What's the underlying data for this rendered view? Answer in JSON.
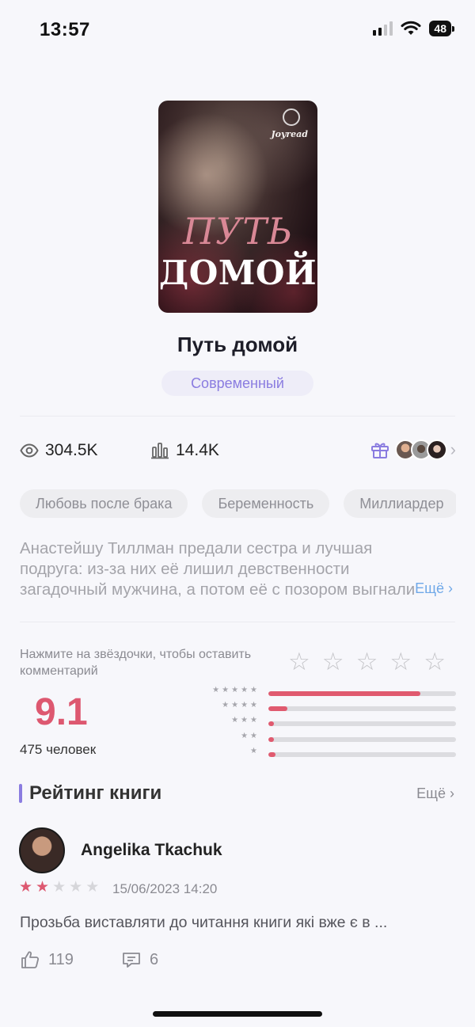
{
  "status_bar": {
    "time": "13:57",
    "battery": "48"
  },
  "book": {
    "cover_brand": "Joyread",
    "cover_title_line1": "ПУТЬ",
    "cover_title_line2": "ДОМОЙ",
    "title": "Путь домой",
    "genre": "Современный"
  },
  "stats": {
    "views": "304.5K",
    "popularity": "14.4K",
    "views_icon": "eye-icon",
    "popularity_icon": "bars-icon",
    "gift_icon": "gift-icon"
  },
  "tags": [
    "Любовь после брака",
    "Беременность",
    "Миллиардер"
  ],
  "description": {
    "text": "Анастейшу Тиллман предали сестра и лучшая подруга: из-за них её лишил девственности загадочный мужчина, а потом её с позором выгнали из дома.",
    "more_label": "Ещё ›"
  },
  "rating": {
    "hint": "Нажмите на звёздочки, чтобы оставить комментарий",
    "score": "9.1",
    "raters": "475 человек",
    "distribution": [
      {
        "stars": "★★★★★",
        "fraction": 0.81
      },
      {
        "stars": "★★★★",
        "fraction": 0.1
      },
      {
        "stars": "★★★",
        "fraction": 0.03
      },
      {
        "stars": "★★",
        "fraction": 0.03
      },
      {
        "stars": "★",
        "fraction": 0.04
      }
    ]
  },
  "reviews_section": {
    "title": "Рейтинг книги",
    "more_label": "Ещё ›"
  },
  "review": {
    "name": "Angelika Tkachuk",
    "stars": 2,
    "date": "15/06/2023 14:20",
    "text": "Прозьба виставляти до читання книги які вже є в ...",
    "likes": "119",
    "comments": "6"
  },
  "colors": {
    "accent": "#8a7ce0",
    "rating": "#dd5870",
    "link": "#6fa8e8"
  }
}
